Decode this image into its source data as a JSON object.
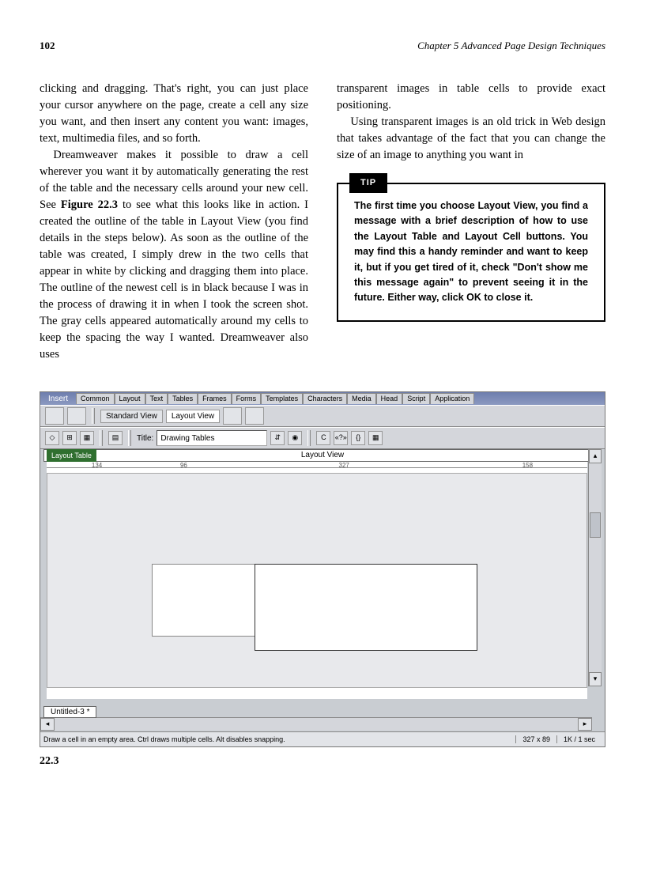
{
  "header": {
    "page_number": "102",
    "chapter": "Chapter 5    Advanced Page Design Techniques"
  },
  "body": {
    "left": {
      "p1": "clicking and dragging. That's right, you can just place your cursor anywhere on the page, create a cell any size you want, and then insert any content you want: images, text, multimedia files, and so forth.",
      "p2a": "Dreamweaver makes it possible to draw a cell wherever you want it by automatically generating the rest of the table and the necessary cells around your new cell. See ",
      "p2fig": "Figure 22.3",
      "p2b": " to see what this looks like in action. I created the outline of the table in Layout View (you find details in the steps below). As soon as the outline of the table was created, I simply drew in the two cells that appear in white by clicking and dragging them into place. The outline of the newest cell is in black because I was in the process of drawing it in when I took the screen shot. The gray cells appeared automatically around my cells to keep the spacing the way I wanted. Dreamweaver also uses"
    },
    "right": {
      "p1": "transparent images in table cells to provide exact positioning.",
      "p2": "Using transparent images is an old trick in Web design that takes advantage of the fact that you can change the size of an image to anything you want in"
    }
  },
  "tip": {
    "label": "TIP",
    "text": "The first time you choose Layout View, you find a message with a brief description of how to use the Layout Table and Layout Cell buttons. You may find this a handy reminder and want to keep it, but if you get tired of it, check \"Don't show me this message again\" to prevent seeing it in the future. Either way, click OK to close it."
  },
  "screenshot": {
    "insert_label": "Insert",
    "tabs": [
      "Common",
      "Layout",
      "Text",
      "Tables",
      "Frames",
      "Forms",
      "Templates",
      "Characters",
      "Media",
      "Head",
      "Script",
      "Application"
    ],
    "standard_view": "Standard View",
    "layout_view": "Layout View",
    "title_label": "Title:",
    "title_value": "Drawing Tables",
    "layout_view_header": "Layout View",
    "layout_table_badge": "Layout Table",
    "col_widths": [
      "134",
      "96",
      "327",
      "158"
    ],
    "doc_tab": "Untitled-3 *",
    "status_msg": "Draw a cell in an empty area. Ctrl draws multiple cells. Alt disables snapping.",
    "status_dims": "327 x 89",
    "status_size": "1K / 1 sec"
  },
  "figure_number": "22.3"
}
